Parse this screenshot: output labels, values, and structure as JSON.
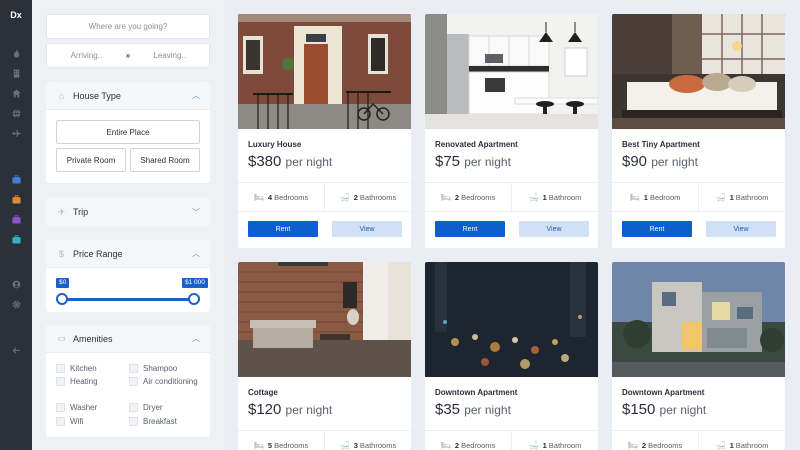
{
  "app": {
    "logo": "Dx"
  },
  "rail": {
    "icons": [
      "fire-icon",
      "building-icon",
      "home-icon",
      "globe-icon",
      "plane-icon",
      "suitcase-icon",
      "suitcase-icon",
      "suitcase-icon",
      "suitcase-icon",
      "user-icon",
      "gear-icon",
      "arrow-left-icon"
    ]
  },
  "search": {
    "placeholder": "Where are you going?",
    "arriving": "Arriving..",
    "leaving": "Leaving..",
    "separator": "»"
  },
  "house_type": {
    "title": "House Type",
    "options": [
      "Entire Place",
      "Private Room",
      "Shared Room"
    ]
  },
  "trip": {
    "title": "Trip"
  },
  "price_range": {
    "title": "Price Range",
    "min_label": "$0",
    "max_label": "$1 000"
  },
  "amenities": {
    "title": "Amenities",
    "items": [
      "Kitchen",
      "Heating",
      "Washer",
      "Wifi",
      "Shampoo",
      "Air conditioning",
      "Dryer",
      "Breakfast"
    ]
  },
  "listings": [
    {
      "title": "Luxury House",
      "price": "$380",
      "per": "per night",
      "bedrooms": "4",
      "bed_label": "Bedrooms",
      "bathrooms": "2",
      "bath_label": "Bathrooms",
      "rent": "Rent",
      "view": "View"
    },
    {
      "title": "Renovated Apartment",
      "price": "$75",
      "per": "per night",
      "bedrooms": "2",
      "bed_label": "Bedrooms",
      "bathrooms": "1",
      "bath_label": "Bathroom",
      "rent": "Rent",
      "view": "View"
    },
    {
      "title": "Best Tiny Apartment",
      "price": "$90",
      "per": "per night",
      "bedrooms": "1",
      "bed_label": "Bedroom",
      "bathrooms": "1",
      "bath_label": "Bathroom",
      "rent": "Rent",
      "view": "View"
    },
    {
      "title": "Cottage",
      "price": "$120",
      "per": "per night",
      "bedrooms": "5",
      "bed_label": "Bedrooms",
      "bathrooms": "3",
      "bath_label": "Bathrooms"
    },
    {
      "title": "Downtown Apartment",
      "price": "$35",
      "per": "per night",
      "bedrooms": "2",
      "bed_label": "Bedrooms",
      "bathrooms": "1",
      "bath_label": "Bathroom"
    },
    {
      "title": "Downtown Apartment",
      "price": "$150",
      "per": "per night",
      "bedrooms": "2",
      "bed_label": "Bedrooms",
      "bathrooms": "1",
      "bath_label": "Bathroom"
    }
  ]
}
